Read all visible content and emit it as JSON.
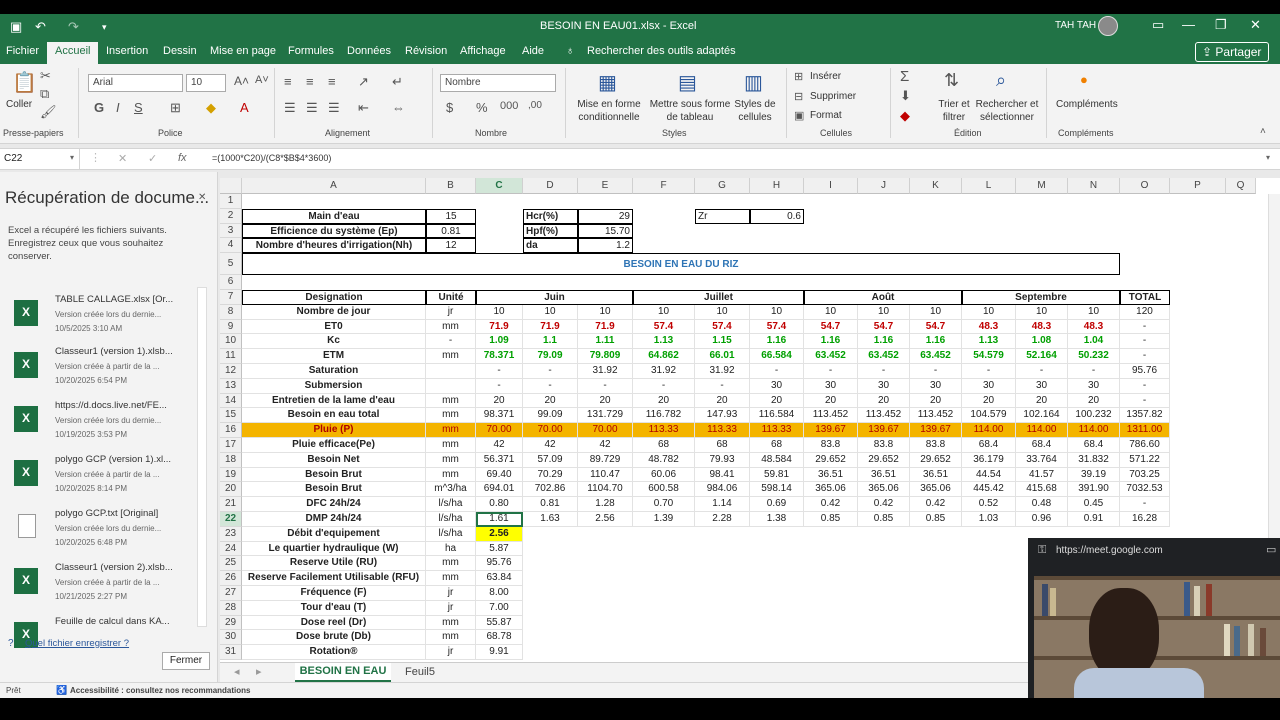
{
  "app": {
    "quick_access": {
      "save_icon": "save-icon",
      "undo_icon": "undo-icon",
      "redo_icon": "redo-icon",
      "customize_icon": "chevron-down-icon"
    },
    "title": "BESOIN EN EAU01.xlsx - Excel",
    "user": "TAH TAH",
    "share_label": "Partager"
  },
  "tabs": [
    "Fichier",
    "Accueil",
    "Insertion",
    "Dessin",
    "Mise en page",
    "Formules",
    "Données",
    "Révision",
    "Affichage",
    "Aide"
  ],
  "search_hint": "Rechercher des outils adaptés",
  "ribbon": {
    "paste": "Coller",
    "clipboard_label": "Presse-papiers",
    "font_name": "Arial",
    "font_size": "10",
    "font_label": "Police",
    "align_label": "Alignement",
    "number_format": "Nombre",
    "number_label": "Nombre",
    "cond_format": "Mise en forme conditionnelle",
    "format_table": "Mettre sous forme de tableau",
    "cell_styles": "Styles de cellules",
    "styles_label": "Styles",
    "insert": "Insérer",
    "delete": "Supprimer",
    "format": "Format",
    "cells_label": "Cellules",
    "sort_filter": "Trier et filtrer",
    "find_select": "Rechercher et sélectionner",
    "editing_label": "Édition",
    "addins": "Compléments",
    "addins_label": "Compléments"
  },
  "formula_bar": {
    "name_box": "C22",
    "formula": "=(1000*C20)/(C8*$B$4*3600)"
  },
  "recovery": {
    "title": "Récupération de docume...",
    "desc": "Excel a récupéré les fichiers suivants. Enregistrez ceux que vous souhaitez conserver.",
    "items": [
      {
        "name": "TABLE CALLAGE.xlsx  [Or...",
        "sub": "Version créée lors du dernie...",
        "date": "10/5/2025 3:10 AM",
        "icon": "excel"
      },
      {
        "name": "Classeur1 (version 1).xlsb...",
        "sub": "Version créée à partir de la ...",
        "date": "10/20/2025 6:54 PM",
        "icon": "excel"
      },
      {
        "name": "https://d.docs.live.net/FE...",
        "sub": "Version créée lors du dernie...",
        "date": "10/19/2025 3:53 PM",
        "icon": "excel"
      },
      {
        "name": "polygo GCP (version 1).xl...",
        "sub": "Version créée à partir de la ...",
        "date": "10/20/2025 8:14 PM",
        "icon": "excel"
      },
      {
        "name": "polygo GCP.txt  [Original]",
        "sub": "Version créée lors du dernie...",
        "date": "10/20/2025 6:48 PM",
        "icon": "txt"
      },
      {
        "name": "Classeur1 (version 2).xlsb...",
        "sub": "Version créée à partir de la ...",
        "date": "10/21/2025 2:27 PM",
        "icon": "excel"
      },
      {
        "name": "Feuille de calcul dans KA...",
        "sub": "",
        "date": "",
        "icon": "excel"
      }
    ],
    "help": "Quel fichier enregistrer ?",
    "close": "Fermer"
  },
  "sheet": {
    "columns": [
      "A",
      "B",
      "C",
      "D",
      "E",
      "F",
      "G",
      "H",
      "I",
      "J",
      "K",
      "L",
      "M",
      "N",
      "O",
      "P",
      "Q"
    ],
    "rows": [
      "1",
      "2",
      "3",
      "4",
      "5",
      "6",
      "7",
      "8",
      "9",
      "10",
      "11",
      "12",
      "13",
      "14",
      "15",
      "16",
      "17",
      "18",
      "19",
      "20",
      "21",
      "22",
      "23",
      "24",
      "25",
      "26",
      "27",
      "28",
      "29",
      "30",
      "31"
    ],
    "params": [
      [
        "Main d'eau",
        "15"
      ],
      [
        "Efficience du système (Ep)",
        "0.81"
      ],
      [
        "Nombre d'heures d'irrigation(Nh)",
        "12"
      ]
    ],
    "params2": [
      [
        "Hcr(%)",
        "29"
      ],
      [
        "Hpf(%)",
        "15.70"
      ],
      [
        "da",
        "1.2"
      ]
    ],
    "zr": [
      "Zr",
      "0.6"
    ],
    "table_title": "BESOIN EN EAU DU RIZ",
    "header": {
      "designation": "Designation",
      "unit": "Unité",
      "months": [
        "Juin",
        "Juillet",
        "Août",
        "Septembre"
      ],
      "total": "TOTAL"
    },
    "data": [
      [
        "Nombre de jour",
        "jr",
        "10",
        "10",
        "10",
        "10",
        "10",
        "10",
        "10",
        "10",
        "10",
        "10",
        "10",
        "10",
        "120"
      ],
      [
        "ET0",
        "mm",
        "71.9",
        "71.9",
        "71.9",
        "57.4",
        "57.4",
        "57.4",
        "54.7",
        "54.7",
        "54.7",
        "48.3",
        "48.3",
        "48.3",
        "-"
      ],
      [
        "Kc",
        "-",
        "1.09",
        "1.1",
        "1.11",
        "1.13",
        "1.15",
        "1.16",
        "1.16",
        "1.16",
        "1.16",
        "1.13",
        "1.08",
        "1.04",
        "-"
      ],
      [
        "ETM",
        "mm",
        "78.371",
        "79.09",
        "79.809",
        "64.862",
        "66.01",
        "66.584",
        "63.452",
        "63.452",
        "63.452",
        "54.579",
        "52.164",
        "50.232",
        "-"
      ],
      [
        "Saturation",
        "",
        "-",
        "-",
        "31.92",
        "31.92",
        "31.92",
        "-",
        "-",
        "-",
        "-",
        "-",
        "-",
        "-",
        "95.76"
      ],
      [
        "Submersion",
        "",
        "-",
        "-",
        "-",
        "-",
        "-",
        "30",
        "30",
        "30",
        "30",
        "30",
        "30",
        "30",
        "-"
      ],
      [
        "Entretien de la lame d'eau",
        "mm",
        "20",
        "20",
        "20",
        "20",
        "20",
        "20",
        "20",
        "20",
        "20",
        "20",
        "20",
        "20",
        "-"
      ],
      [
        "Besoin en eau total",
        "mm",
        "98.371",
        "99.09",
        "131.729",
        "116.782",
        "147.93",
        "116.584",
        "113.452",
        "113.452",
        "113.452",
        "104.579",
        "102.164",
        "100.232",
        "1357.82"
      ],
      [
        "Pluie (P)",
        "mm",
        "70.00",
        "70.00",
        "70.00",
        "113.33",
        "113.33",
        "113.33",
        "139.67",
        "139.67",
        "139.67",
        "114.00",
        "114.00",
        "114.00",
        "1311.00"
      ],
      [
        "Pluie efficace(Pe)",
        "mm",
        "42",
        "42",
        "42",
        "68",
        "68",
        "68",
        "83.8",
        "83.8",
        "83.8",
        "68.4",
        "68.4",
        "68.4",
        "786.60"
      ],
      [
        "Besoin Net",
        "mm",
        "56.371",
        "57.09",
        "89.729",
        "48.782",
        "79.93",
        "48.584",
        "29.652",
        "29.652",
        "29.652",
        "36.179",
        "33.764",
        "31.832",
        "571.22"
      ],
      [
        "Besoin Brut",
        "mm",
        "69.40",
        "70.29",
        "110.47",
        "60.06",
        "98.41",
        "59.81",
        "36.51",
        "36.51",
        "36.51",
        "44.54",
        "41.57",
        "39.19",
        "703.25"
      ],
      [
        "Besoin Brut",
        "m^3/ha",
        "694.01",
        "702.86",
        "1104.70",
        "600.58",
        "984.06",
        "598.14",
        "365.06",
        "365.06",
        "365.06",
        "445.42",
        "415.68",
        "391.90",
        "7032.53"
      ],
      [
        "DFC 24h/24",
        "l/s/ha",
        "0.80",
        "0.81",
        "1.28",
        "0.70",
        "1.14",
        "0.69",
        "0.42",
        "0.42",
        "0.42",
        "0.52",
        "0.48",
        "0.45",
        "-"
      ],
      [
        "DMP 24h/24",
        "l/s/ha",
        "1.61",
        "1.63",
        "2.56",
        "1.39",
        "2.28",
        "1.38",
        "0.85",
        "0.85",
        "0.85",
        "1.03",
        "0.96",
        "0.91",
        "16.28"
      ]
    ],
    "lower": [
      [
        "Débit d'equipement",
        "l/s/ha",
        "2.56"
      ],
      [
        "Le quartier hydraulique (W)",
        "ha",
        "5.87"
      ],
      [
        "Reserve Utile (RU)",
        "mm",
        "95.76"
      ],
      [
        "Reserve Facilement Utilisable (RFU)",
        "mm",
        "63.84"
      ],
      [
        "Fréquence (F)",
        "jr",
        "8.00"
      ],
      [
        "Tour d'eau (T)",
        "jr",
        "7.00"
      ],
      [
        "Dose reel (Dr)",
        "mm",
        "55.87"
      ],
      [
        "Dose brute (Db)",
        "mm",
        "68.78"
      ],
      [
        "Rotation®",
        "jr",
        "9.91"
      ]
    ]
  },
  "sheet_tabs": [
    "BESOIN EN EAU",
    "Feuil5"
  ],
  "status": {
    "ready": "Prêt",
    "accessibility": "Accessibilité : consultez nos recommandations"
  },
  "meet": {
    "url": "https://meet.google.com"
  },
  "colors": {
    "excel_green": "#217346",
    "pluie_row": "#f4b400",
    "red_values": "#c00000",
    "green_values": "#00a000",
    "title_blue": "#2e74b5",
    "highlight": "#ffff00"
  }
}
